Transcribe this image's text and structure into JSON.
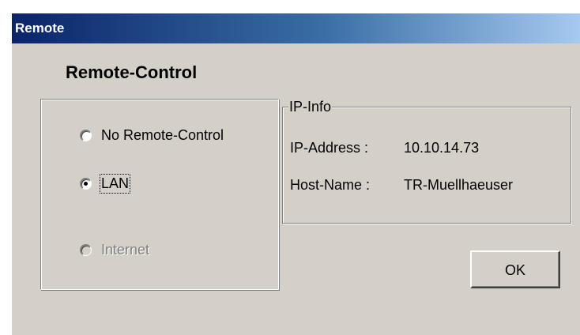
{
  "window": {
    "title": "Remote"
  },
  "heading": "Remote-Control",
  "options": {
    "no_remote": "No Remote-Control",
    "lan": "LAN",
    "internet": "Internet",
    "selected": "LAN"
  },
  "ip_info": {
    "legend": "IP-Info",
    "ip_label": "IP-Address :",
    "ip_value": "10.10.14.73",
    "host_label": "Host-Name :",
    "host_value": "TR-Muellhaeuser"
  },
  "buttons": {
    "ok": "OK"
  },
  "colors": {
    "dialog_bg": "#d4d0c8",
    "titlebar_start": "#0a246a",
    "titlebar_end": "#a6caf0"
  }
}
